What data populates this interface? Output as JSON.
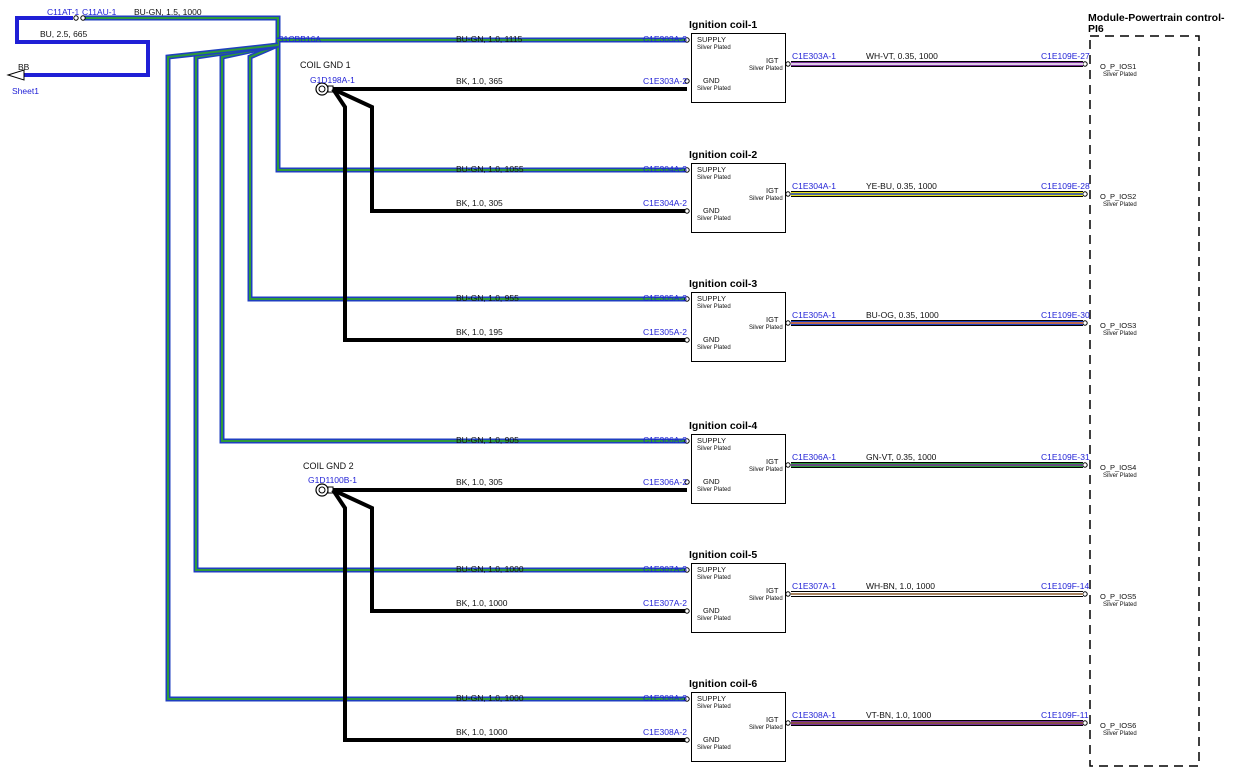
{
  "module": {
    "title_line1": "Module-Powertrain control-",
    "title_line2": "PI6"
  },
  "top": {
    "conn_left": "C11AT-1",
    "conn_right": "C11AU-1",
    "wire_top": "BU-GN, 1.5, 1000",
    "wire_loop": "BU, 2.5, 665",
    "bb_label": "BB",
    "sheet_link": "Sheet1",
    "splice": "S1CBB16A"
  },
  "grounds": [
    {
      "title": "COIL GND 1",
      "conn": "G1D198A-1"
    },
    {
      "title": "COIL GND 2",
      "conn": "G1D1100B-1"
    }
  ],
  "coil_pins": {
    "supply": "SUPPLY",
    "gnd": "GND",
    "igt": "IGT",
    "plated": "Silver Plated"
  },
  "coils": [
    {
      "title": "Ignition coil-1",
      "supply_wire": "BU-GN, 1.0, 1115",
      "supply_conn": "C1E303A-3",
      "gnd_wire": "BK, 1.0, 365",
      "gnd_conn": "C1E303A-2",
      "igt_conn": "C1E303A-1",
      "sig_wire": "WH-VT, 0.35, 1000",
      "ecm_conn": "C1E109E-27",
      "ecm_pin": "O_P_IOS1",
      "color_a": "#7a2f9a",
      "color_b": "#ffffff"
    },
    {
      "title": "Ignition coil-2",
      "supply_wire": "BU-GN, 1.0, 1055",
      "supply_conn": "C1E304A-3",
      "gnd_wire": "BK, 1.0, 305",
      "gnd_conn": "C1E304A-2",
      "igt_conn": "C1E304A-1",
      "sig_wire": "YE-BU, 0.35, 1000",
      "ecm_conn": "C1E109E-28",
      "ecm_pin": "O_P_IOS2",
      "color_a": "#e8e31a",
      "color_b": "#1f3fc0"
    },
    {
      "title": "Ignition coil-3",
      "supply_wire": "BU-GN, 1.0, 955",
      "supply_conn": "C1E305A-3",
      "gnd_wire": "BK, 1.0, 195",
      "gnd_conn": "C1E305A-2",
      "igt_conn": "C1E305A-1",
      "sig_wire": "BU-OG, 0.35, 1000",
      "ecm_conn": "C1E109E-30",
      "ecm_pin": "O_P_IOS3",
      "color_a": "#1f3fc0",
      "color_b": "#f0782a"
    },
    {
      "title": "Ignition coil-4",
      "supply_wire": "BU-GN, 1.0, 905",
      "supply_conn": "C1E306A-3",
      "gnd_wire": "BK, 1.0, 305",
      "gnd_conn": "C1E306A-2",
      "igt_conn": "C1E306A-1",
      "sig_wire": "GN-VT, 0.35, 1000",
      "ecm_conn": "C1E109E-31",
      "ecm_pin": "O_P_IOS4",
      "color_a": "#2e9a3a",
      "color_b": "#7a2f9a"
    },
    {
      "title": "Ignition coil-5",
      "supply_wire": "BU-GN, 1.0, 1000",
      "supply_conn": "C1E307A-3",
      "gnd_wire": "BK, 1.0, 1000",
      "gnd_conn": "C1E307A-2",
      "igt_conn": "C1E307A-1",
      "sig_wire": "WH-BN, 1.0, 1000",
      "ecm_conn": "C1E109F-14",
      "ecm_pin": "O_P_IOS5",
      "color_a": "#ffffff",
      "color_b": "#8a5a2a"
    },
    {
      "title": "Ignition coil-6",
      "supply_wire": "BU-GN, 1.0, 1000",
      "supply_conn": "C1E308A-3",
      "gnd_wire": "BK, 1.0, 1000",
      "gnd_conn": "C1E308A-2",
      "igt_conn": "C1E308A-1",
      "sig_wire": "VT-BN, 1.0, 1000",
      "ecm_conn": "C1E109F-11",
      "ecm_pin": "O_P_IOS6",
      "color_a": "#7a2f9a",
      "color_b": "#8a5a2a"
    }
  ],
  "colors": {
    "bu_gn_outer": "#1f3fc0",
    "bu_gn_inner": "#2e9a3a",
    "bu": "#1f1fd6",
    "bk": "#000000"
  }
}
